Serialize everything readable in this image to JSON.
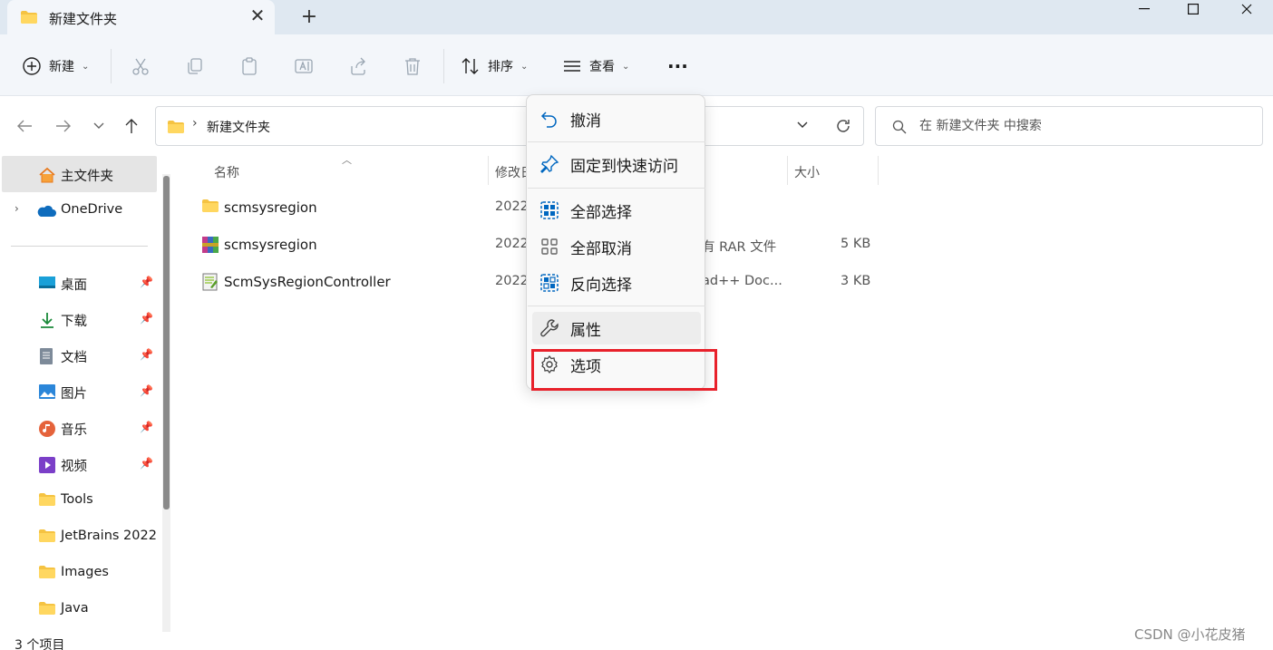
{
  "tab": {
    "title": "新建文件夹",
    "close": "✕",
    "new_tab": "+"
  },
  "toolbar": {
    "new_label": "新建",
    "sort_label": "排序",
    "view_label": "查看",
    "more_label": "···"
  },
  "address": {
    "path": "新建文件夹",
    "separator": "›"
  },
  "search": {
    "placeholder": "在 新建文件夹 中搜索"
  },
  "sidebar": {
    "home": "主文件夹",
    "onedrive": "OneDrive",
    "items": [
      {
        "label": "桌面",
        "icon": "desktop-icon",
        "pinned": true
      },
      {
        "label": "下载",
        "icon": "download-icon",
        "pinned": true
      },
      {
        "label": "文档",
        "icon": "document-icon",
        "pinned": true
      },
      {
        "label": "图片",
        "icon": "pictures-icon",
        "pinned": true
      },
      {
        "label": "音乐",
        "icon": "music-icon",
        "pinned": true
      },
      {
        "label": "视频",
        "icon": "video-icon",
        "pinned": true
      },
      {
        "label": "Tools",
        "icon": "folder-icon",
        "pinned": false
      },
      {
        "label": "JetBrains 2022",
        "icon": "folder-icon",
        "pinned": false
      },
      {
        "label": "Images",
        "icon": "folder-icon",
        "pinned": false
      },
      {
        "label": "Java",
        "icon": "folder-icon",
        "pinned": false
      }
    ]
  },
  "columns": {
    "name": "名称",
    "date": "修改日",
    "size": "大小"
  },
  "files": [
    {
      "name": "scmsysregion",
      "date": "2022",
      "type": "",
      "size": "",
      "icon": "folder-icon"
    },
    {
      "name": "scmsysregion",
      "date": "2022",
      "type": "有 RAR 文件",
      "size": "5 KB",
      "icon": "rar-archive-icon"
    },
    {
      "name": "ScmSysRegionController",
      "date": "2022",
      "type": "ad++ Doc...",
      "size": "3 KB",
      "icon": "notepadpp-document-icon"
    }
  ],
  "menu": {
    "undo": "撤消",
    "pin_quick": "固定到快速访问",
    "select_all": "全部选择",
    "select_none": "全部取消",
    "invert": "反向选择",
    "properties": "属性",
    "options": "选项"
  },
  "status": {
    "count": "3 个项目"
  },
  "watermark": "CSDN @小花皮猪",
  "colors": {
    "accent": "#0067c0",
    "highlight": "#e8212b",
    "folder": "#f5c342"
  }
}
